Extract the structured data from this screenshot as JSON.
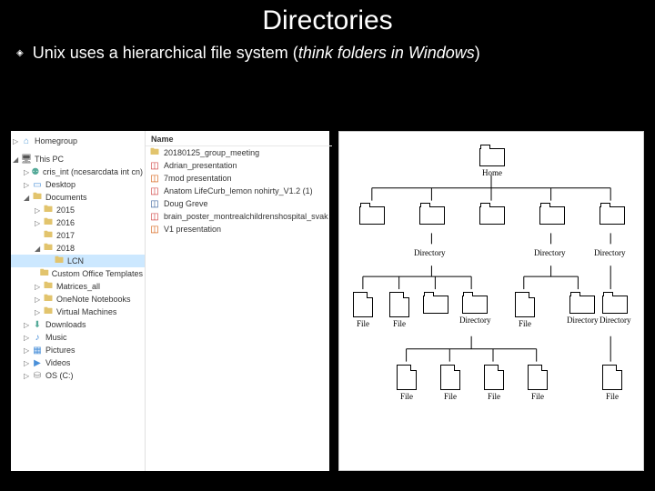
{
  "title": "Directories",
  "bullet": {
    "text_plain": "Unix uses a hierarchical file system (",
    "text_italic": "think folders in Windows",
    "text_end": ")"
  },
  "nav": {
    "homegroup": "Homegroup",
    "this_pc": "This PC",
    "network_drive": "cris_int (ncesarcdata int cn)",
    "desktop": "Desktop",
    "documents": "Documents",
    "y2015": "2015",
    "y2016": "2016",
    "y2017": "2017",
    "y2018": "2018",
    "lcn": "LCN",
    "custom_templates": "Custom Office Templates",
    "matrices": "Matrices_all",
    "onenote": "OneNote Notebooks",
    "vms": "Virtual Machines",
    "downloads": "Downloads",
    "music": "Music",
    "pictures": "Pictures",
    "videos": "Videos",
    "osc": "OS (C:)"
  },
  "content": {
    "header": "Name",
    "items": [
      {
        "icon": "folder",
        "label": "20180125_group_meeting"
      },
      {
        "icon": "pdf",
        "label": "Adrian_presentation"
      },
      {
        "icon": "ppt",
        "label": "7mod presentation"
      },
      {
        "icon": "pdf",
        "label": "Anatom LifeCurb_lemon nohirty_V1.2 (1)"
      },
      {
        "icon": "word",
        "label": "Doug Greve"
      },
      {
        "icon": "pdf",
        "label": "brain_poster_montrealchildrenshospital_svak"
      },
      {
        "icon": "ppt",
        "label": "V1 presentation"
      }
    ]
  },
  "diagram": {
    "home": "Home",
    "directory": "Directory",
    "file": "File"
  }
}
